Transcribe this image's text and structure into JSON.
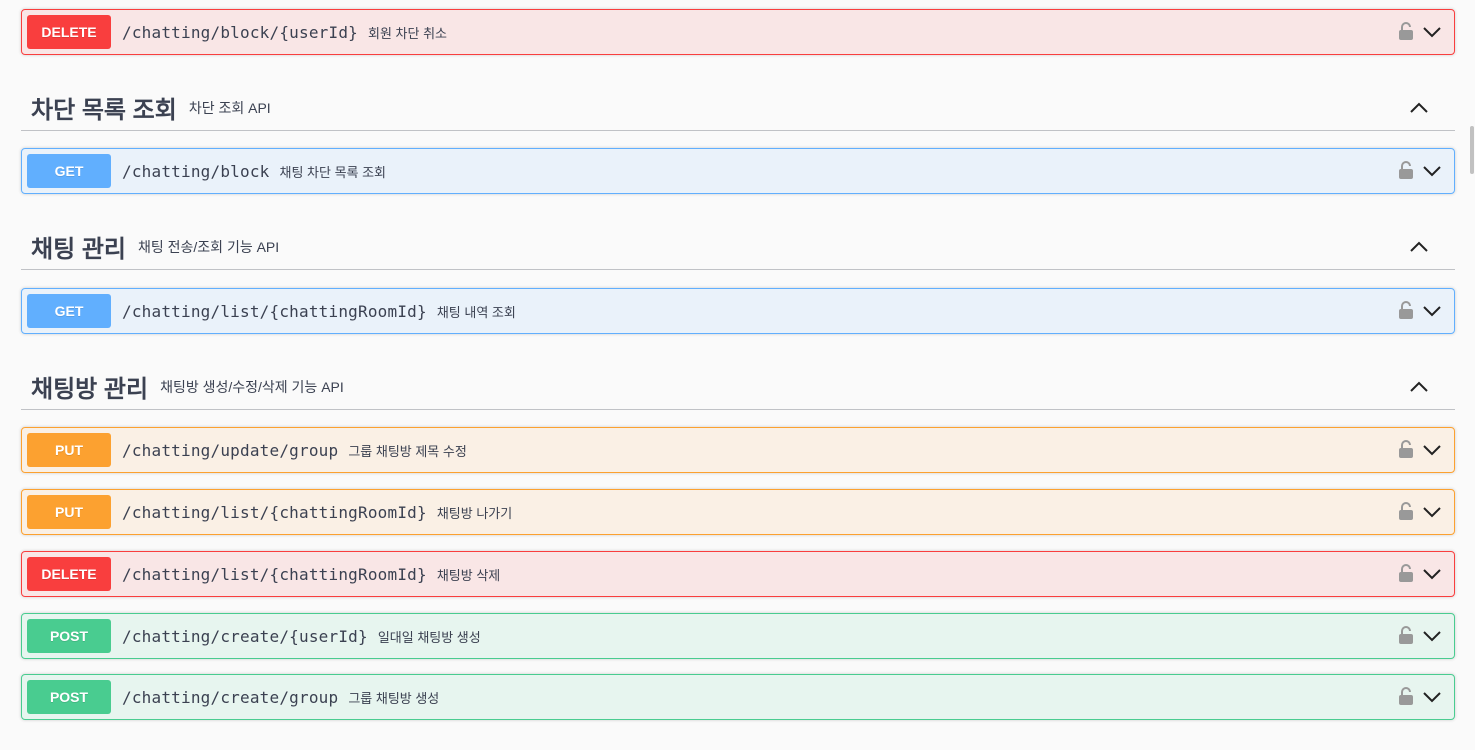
{
  "operations": [
    {
      "method": "DELETE",
      "path": "/chatting/block/{userId}",
      "summary": "회원 차단 취소"
    },
    {
      "method": "GET",
      "path": "/chatting/block",
      "summary": "채팅 차단 목록 조회"
    },
    {
      "method": "GET",
      "path": "/chatting/list/{chattingRoomId}",
      "summary": "채팅 내역 조회"
    },
    {
      "method": "PUT",
      "path": "/chatting/update/group",
      "summary": "그룹 채팅방 제목 수정"
    },
    {
      "method": "PUT",
      "path": "/chatting/list/{chattingRoomId}",
      "summary": "채팅방 나가기"
    },
    {
      "method": "DELETE",
      "path": "/chatting/list/{chattingRoomId}",
      "summary": "채팅방 삭제"
    },
    {
      "method": "POST",
      "path": "/chatting/create/{userId}",
      "summary": "일대일 채팅방 생성"
    },
    {
      "method": "POST",
      "path": "/chatting/create/group",
      "summary": "그룹 채팅방 생성"
    }
  ],
  "tags": [
    {
      "name": "차단 목록 조회",
      "description": "차단 조회 API"
    },
    {
      "name": "채팅 관리",
      "description": "채팅 전송/조회 기능 API"
    },
    {
      "name": "채팅방 관리",
      "description": "채팅방 생성/수정/삭제 기능 API"
    }
  ],
  "colors": {
    "delete": "#f93e3e",
    "get": "#61affe",
    "put": "#fca130",
    "post": "#49cc90"
  },
  "icons": {
    "lock": "unlocked-padlock-icon",
    "expand": "chevron-down-icon",
    "collapse": "chevron-up-icon"
  }
}
